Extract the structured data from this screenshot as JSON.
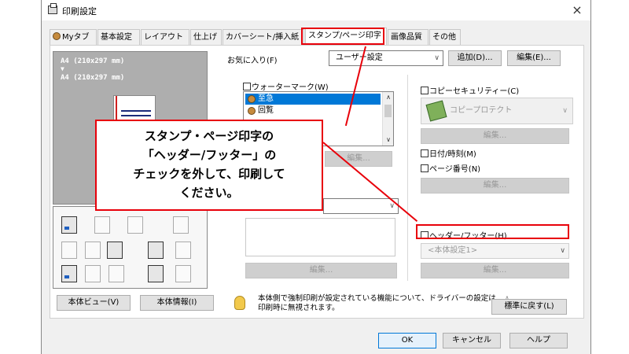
{
  "window": {
    "title": "印刷設定",
    "close_glyph": "×"
  },
  "tabs": [
    {
      "label": "Myタブ",
      "active": false
    },
    {
      "label": "基本設定",
      "active": false
    },
    {
      "label": "レイアウト",
      "active": false
    },
    {
      "label": "仕上げ",
      "active": false
    },
    {
      "label": "カバーシート/挿入紙",
      "active": false
    },
    {
      "label": "スタンプ/ページ印字",
      "active": true
    },
    {
      "label": "画像品質",
      "active": false
    },
    {
      "label": "その他",
      "active": false
    }
  ],
  "preview": {
    "paper_top": "A4 (210x297 mm)",
    "arrow": "▼",
    "paper_bottom": "A4 (210x297 mm)",
    "view_button": "本体ビュー(V)",
    "info_button": "本体情報(I)"
  },
  "favorites": {
    "label": "お気に入り(F)",
    "value": "ユーザー設定",
    "add_button": "追加(D)...",
    "edit_button": "編集(E)..."
  },
  "watermark": {
    "checkbox_label": "ウォーターマーク(W)",
    "items": [
      "至急",
      "回覧"
    ],
    "edit_button": "編集..."
  },
  "overlay": {
    "edit_button": "編集..."
  },
  "copy_security": {
    "checkbox_label": "コピーセキュリティー(C)",
    "value": "コピープロテクト",
    "edit_button": "編集..."
  },
  "datetime": {
    "checkbox_label": "日付/時刻(M)"
  },
  "page_number": {
    "checkbox_label": "ページ番号(N)",
    "edit_button": "編集..."
  },
  "header_footer": {
    "checkbox_label": "ヘッダー/フッター(H)",
    "value": "<本体設定1>",
    "edit_button": "編集..."
  },
  "info": {
    "message": "本体側で強制印刷が設定されている機能について、ドライバーの設定は印刷時に無視されます。",
    "restore_button": "標準に戻す(L)"
  },
  "footer": {
    "ok": "OK",
    "cancel": "キャンセル",
    "help": "ヘルプ"
  },
  "annotation": {
    "line1": "スタンプ・ページ印字の",
    "line2": "「ヘッダー/フッター」の",
    "line3": "チェックを外して、印刷して",
    "line4": "ください。"
  },
  "colors": {
    "annotation_red": "#e8000a",
    "selection_blue": "#0078d7"
  }
}
